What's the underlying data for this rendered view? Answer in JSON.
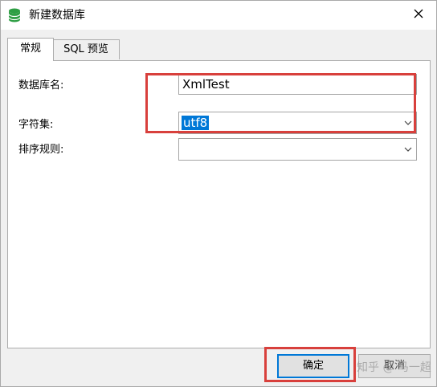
{
  "window": {
    "title": "新建数据库",
    "icon": "database-icon",
    "close_icon": "close-icon"
  },
  "tabs": [
    {
      "label": "常规",
      "active": true
    },
    {
      "label": "SQL 预览",
      "active": false
    }
  ],
  "form": {
    "db_name": {
      "label": "数据库名:",
      "value": "XmlTest"
    },
    "charset": {
      "label": "字符集:",
      "value": "utf8",
      "selected": true
    },
    "collation": {
      "label": "排序规则:",
      "value": ""
    }
  },
  "buttons": {
    "ok_label": "确定",
    "cancel_label": "取消"
  },
  "watermark": "知乎 @ 马一超",
  "colors": {
    "highlight": "#d8403c",
    "selection": "#0078d7",
    "icon": "#2e9e44"
  }
}
